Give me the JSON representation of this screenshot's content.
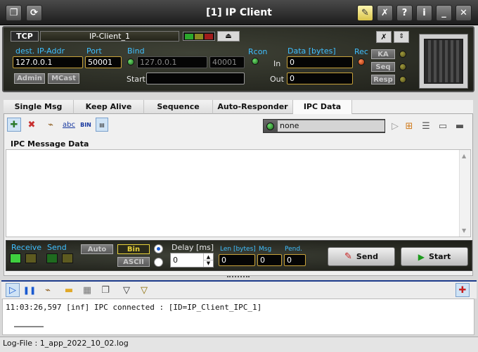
{
  "window": {
    "title": "[1] IP Client"
  },
  "connection": {
    "protocol_tab": "TCP",
    "client_name": "IP-Client_1",
    "dest_ip_label": "dest. IP-Addr",
    "dest_ip_value": "127.0.0.1",
    "port_label": "Port",
    "port_value": "50001",
    "bind_label": "Bind",
    "bind_ip_value": "127.0.0.1",
    "bind_port_value": "40001",
    "start_label": "Start",
    "start_value": "",
    "rcon_label": "Rcon",
    "data_label": "Data [bytes]",
    "in_label": "In",
    "in_value": "0",
    "out_label": "Out",
    "out_value": "0",
    "rec_label": "Rec",
    "ka_button": "KA",
    "seq_button": "Seq",
    "resp_button": "Resp",
    "admin_button": "Admin",
    "mcast_button": "MCast"
  },
  "tabs": [
    {
      "label": "Single Msg"
    },
    {
      "label": "Keep Alive"
    },
    {
      "label": "Sequence"
    },
    {
      "label": "Auto-Responder"
    },
    {
      "label": "IPC Data"
    }
  ],
  "ipc": {
    "toolbar": {
      "abc_icon_text": "abc",
      "bin_icon_text": "BIN",
      "select_value": "none"
    },
    "message_data_label": "IPC Message Data",
    "message_data_value": ""
  },
  "send_panel": {
    "receive_label": "Receive",
    "send_label": "Send",
    "auto_button": "Auto",
    "bin_button": "Bin",
    "ascii_button": "ASCII",
    "delay_label": "Delay [ms]",
    "delay_value": "0",
    "len_label": "Len [bytes]",
    "len_value": "0",
    "msg_label": "Msg",
    "msg_value": "0",
    "pend_label": "Pend.",
    "pend_value": "0",
    "send_button": "Send",
    "start_button": "Start"
  },
  "log": {
    "lines": [
      "11:03:26,597 [inf] IPC connected : [ID=IP_Client_IPC_1]"
    ],
    "file_label": "Log-File : 1_app_2022_10_02.log"
  },
  "colors": {
    "label_blue": "#3fbfff",
    "led_green": "#3fbf3f",
    "led_red": "#e0501a",
    "accent_blue": "#1e3c8c",
    "bin_yellow": "#e8d23a"
  }
}
